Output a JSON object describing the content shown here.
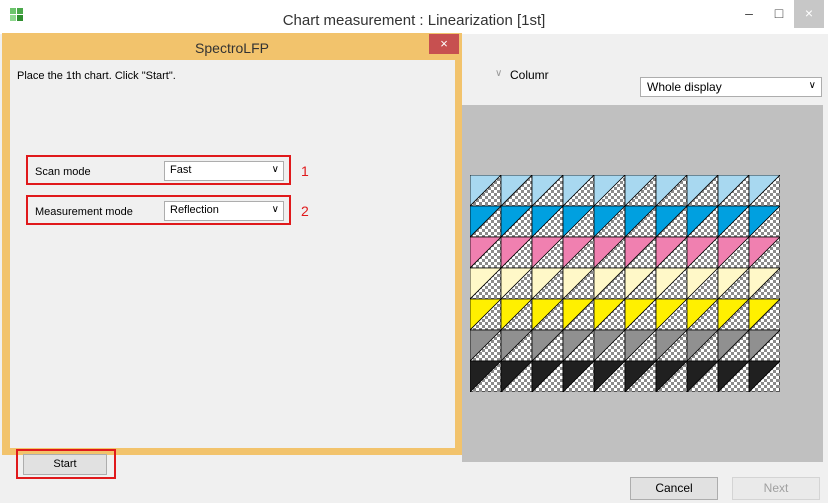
{
  "window": {
    "title": "Chart measurement : Linearization [1st]",
    "minimize": "–",
    "maximize": "□",
    "close": "×"
  },
  "main": {
    "column_label": "Columr",
    "display_select": {
      "value": "Whole display"
    },
    "cancel_label": "Cancel",
    "next_label": "Next"
  },
  "dialog": {
    "title": "SpectroLFP",
    "close": "×",
    "instruction": "Place the 1th chart.  Click \"Start\".",
    "scan_mode": {
      "label": "Scan mode",
      "value": "Fast"
    },
    "measurement_mode": {
      "label": "Measurement mode",
      "value": "Reflection"
    },
    "markers": [
      "1",
      "2"
    ],
    "start_label": "Start"
  },
  "chart_patches": {
    "columns": 10,
    "row_colors": [
      "#a8d8f0",
      "#00a0e0",
      "#f080b0",
      "#fff8c8",
      "#fff000",
      "#909090",
      "#202020"
    ]
  },
  "colors": {
    "dialog_frame": "#f2c36c",
    "highlight": "#e0191b",
    "preview_bg": "#c0c0c0"
  }
}
